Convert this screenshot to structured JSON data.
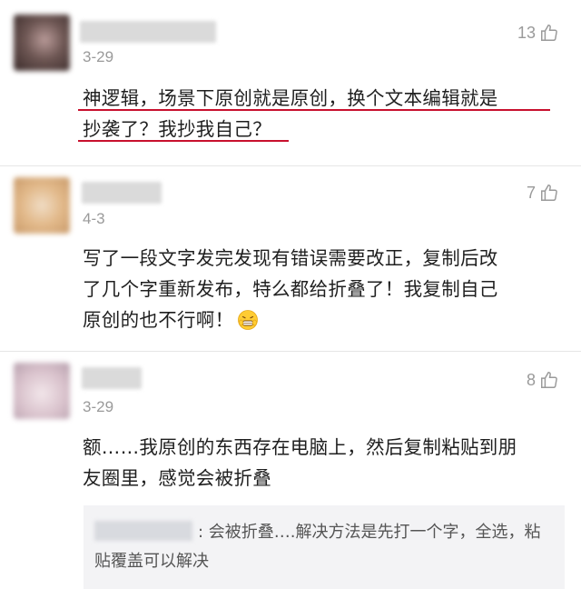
{
  "comments": [
    {
      "date": "3-29",
      "likes": "13",
      "text_line1": "神逻辑，场景下原创就是原创，换个文本编辑就是",
      "text_line2": "抄袭了？我抄我自己？"
    },
    {
      "date": "4-3",
      "likes": "7",
      "text_line1": "写了一段文字发完发现有错误需要改正，复制后改",
      "text_line2": "了几个字重新发布，特么都给折叠了！我复制自己",
      "text_line3": "原创的也不行啊！"
    },
    {
      "date": "3-29",
      "likes": "8",
      "text_line1": "额……我原创的东西存在电脑上，然后复制粘贴到朋",
      "text_line2": "友圈里，感觉会被折叠",
      "reply": ": 会被折叠….解决方法是先打一个字，全选，粘贴覆盖可以解决"
    }
  ],
  "colors": {
    "underline": "#c8102e",
    "meta_gray": "#9a9a9a",
    "reply_bg": "#f3f3f5"
  },
  "icons": {
    "like": "thumbs-up-icon",
    "emoji": "grimace-emoji-icon"
  }
}
